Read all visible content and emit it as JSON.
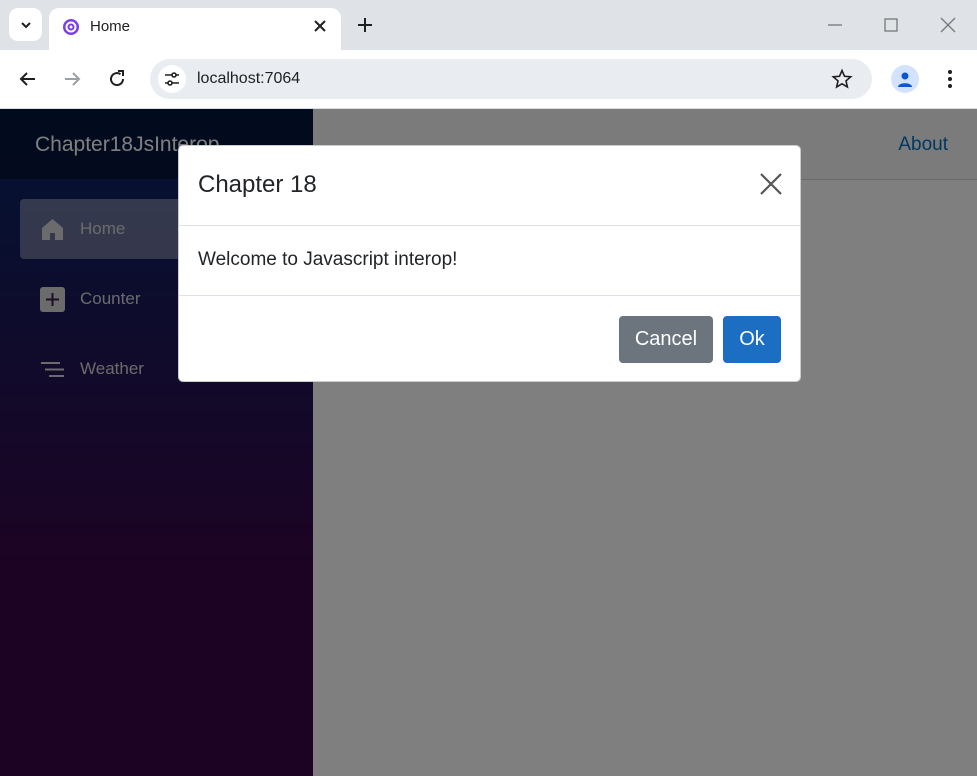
{
  "browser": {
    "tab_title": "Home",
    "url": "localhost:7064"
  },
  "app": {
    "brand": "Chapter18JsInterop",
    "nav": [
      {
        "label": "Home",
        "icon": "house-icon",
        "active": true
      },
      {
        "label": "Counter",
        "icon": "plus-square-icon",
        "active": false
      },
      {
        "label": "Weather",
        "icon": "list-icon",
        "active": false
      }
    ],
    "topbar_link": "About"
  },
  "modal": {
    "title": "Chapter 18",
    "body": "Welcome to Javascript interop!",
    "cancel_label": "Cancel",
    "ok_label": "Ok"
  },
  "colors": {
    "ok_button": "#1b6ec2",
    "cancel_button": "#6c757d",
    "about_link": "#0071c1"
  }
}
